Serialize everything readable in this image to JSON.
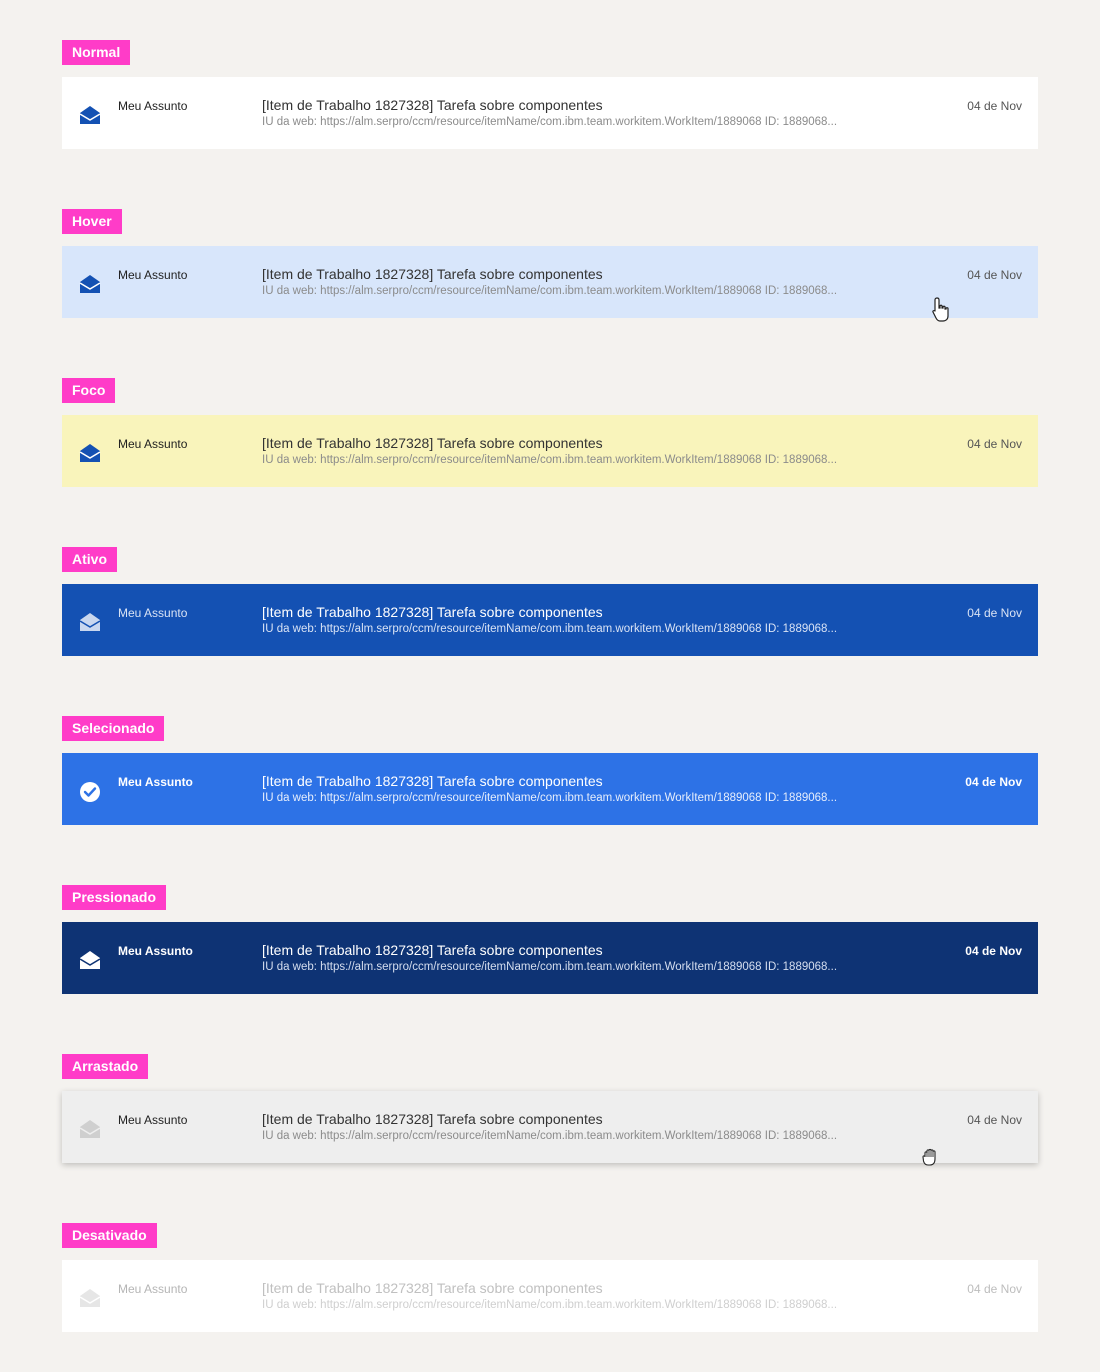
{
  "states": [
    {
      "tag": "Normal",
      "sender": "Meu Assunto",
      "subject": "[Item de Trabalho 1827328] Tarefa sobre componentes",
      "preview": "IU da web: https://alm.serpro/ccm/resource/itemName/com.ibm.team.workitem.WorkItem/1889068 ID: 1889068...",
      "date": "04 de Nov",
      "icon": "envelope-open-icon"
    },
    {
      "tag": "Hover",
      "sender": "Meu Assunto",
      "subject": "[Item de Trabalho 1827328] Tarefa sobre componentes",
      "preview": "IU da web: https://alm.serpro/ccm/resource/itemName/com.ibm.team.workitem.WorkItem/1889068 ID: 1889068...",
      "date": "04 de Nov",
      "icon": "envelope-open-icon"
    },
    {
      "tag": "Foco",
      "sender": "Meu Assunto",
      "subject": "[Item de Trabalho 1827328] Tarefa sobre componentes",
      "preview": "IU da web: https://alm.serpro/ccm/resource/itemName/com.ibm.team.workitem.WorkItem/1889068 ID: 1889068...",
      "date": "04 de Nov",
      "icon": "envelope-open-icon"
    },
    {
      "tag": "Ativo",
      "sender": "Meu Assunto",
      "subject": "[Item de Trabalho 1827328] Tarefa sobre componentes",
      "preview": "IU da web: https://alm.serpro/ccm/resource/itemName/com.ibm.team.workitem.WorkItem/1889068 ID: 1889068...",
      "date": "04 de Nov",
      "icon": "envelope-open-icon"
    },
    {
      "tag": "Selecionado",
      "sender": "Meu Assunto",
      "subject": "[Item de Trabalho 1827328] Tarefa sobre componentes",
      "preview": "IU da web: https://alm.serpro/ccm/resource/itemName/com.ibm.team.workitem.WorkItem/1889068 ID: 1889068...",
      "date": "04 de Nov",
      "icon": "check-circle-icon"
    },
    {
      "tag": "Pressionado",
      "sender": "Meu Assunto",
      "subject": "[Item de Trabalho 1827328] Tarefa sobre componentes",
      "preview": "IU da web: https://alm.serpro/ccm/resource/itemName/com.ibm.team.workitem.WorkItem/1889068 ID: 1889068...",
      "date": "04 de Nov",
      "icon": "envelope-open-icon"
    },
    {
      "tag": "Arrastado",
      "sender": "Meu Assunto",
      "subject": "[Item de Trabalho 1827328] Tarefa sobre componentes",
      "preview": "IU da web: https://alm.serpro/ccm/resource/itemName/com.ibm.team.workitem.WorkItem/1889068 ID: 1889068...",
      "date": "04 de Nov",
      "icon": "envelope-open-icon"
    },
    {
      "tag": "Desativado",
      "sender": "Meu Assunto",
      "subject": "[Item de Trabalho 1827328] Tarefa sobre componentes",
      "preview": "IU da web: https://alm.serpro/ccm/resource/itemName/com.ibm.team.workitem.WorkItem/1889068 ID: 1889068...",
      "date": "04 de Nov",
      "icon": "envelope-open-icon"
    }
  ],
  "colors": {
    "tag_background": "#ff3cc8",
    "page_background": "#f4f2ef",
    "normal": "#ffffff",
    "hover": "#d8e6fb",
    "focus": "#f9f4bb",
    "active": "#1451b3",
    "selected": "#2d72e6",
    "pressed": "#0e3374",
    "dragged": "#eeeeee",
    "disabled": "#ffffff"
  },
  "cursors": [
    "hand-pointer-icon",
    "hand-grab-icon"
  ]
}
